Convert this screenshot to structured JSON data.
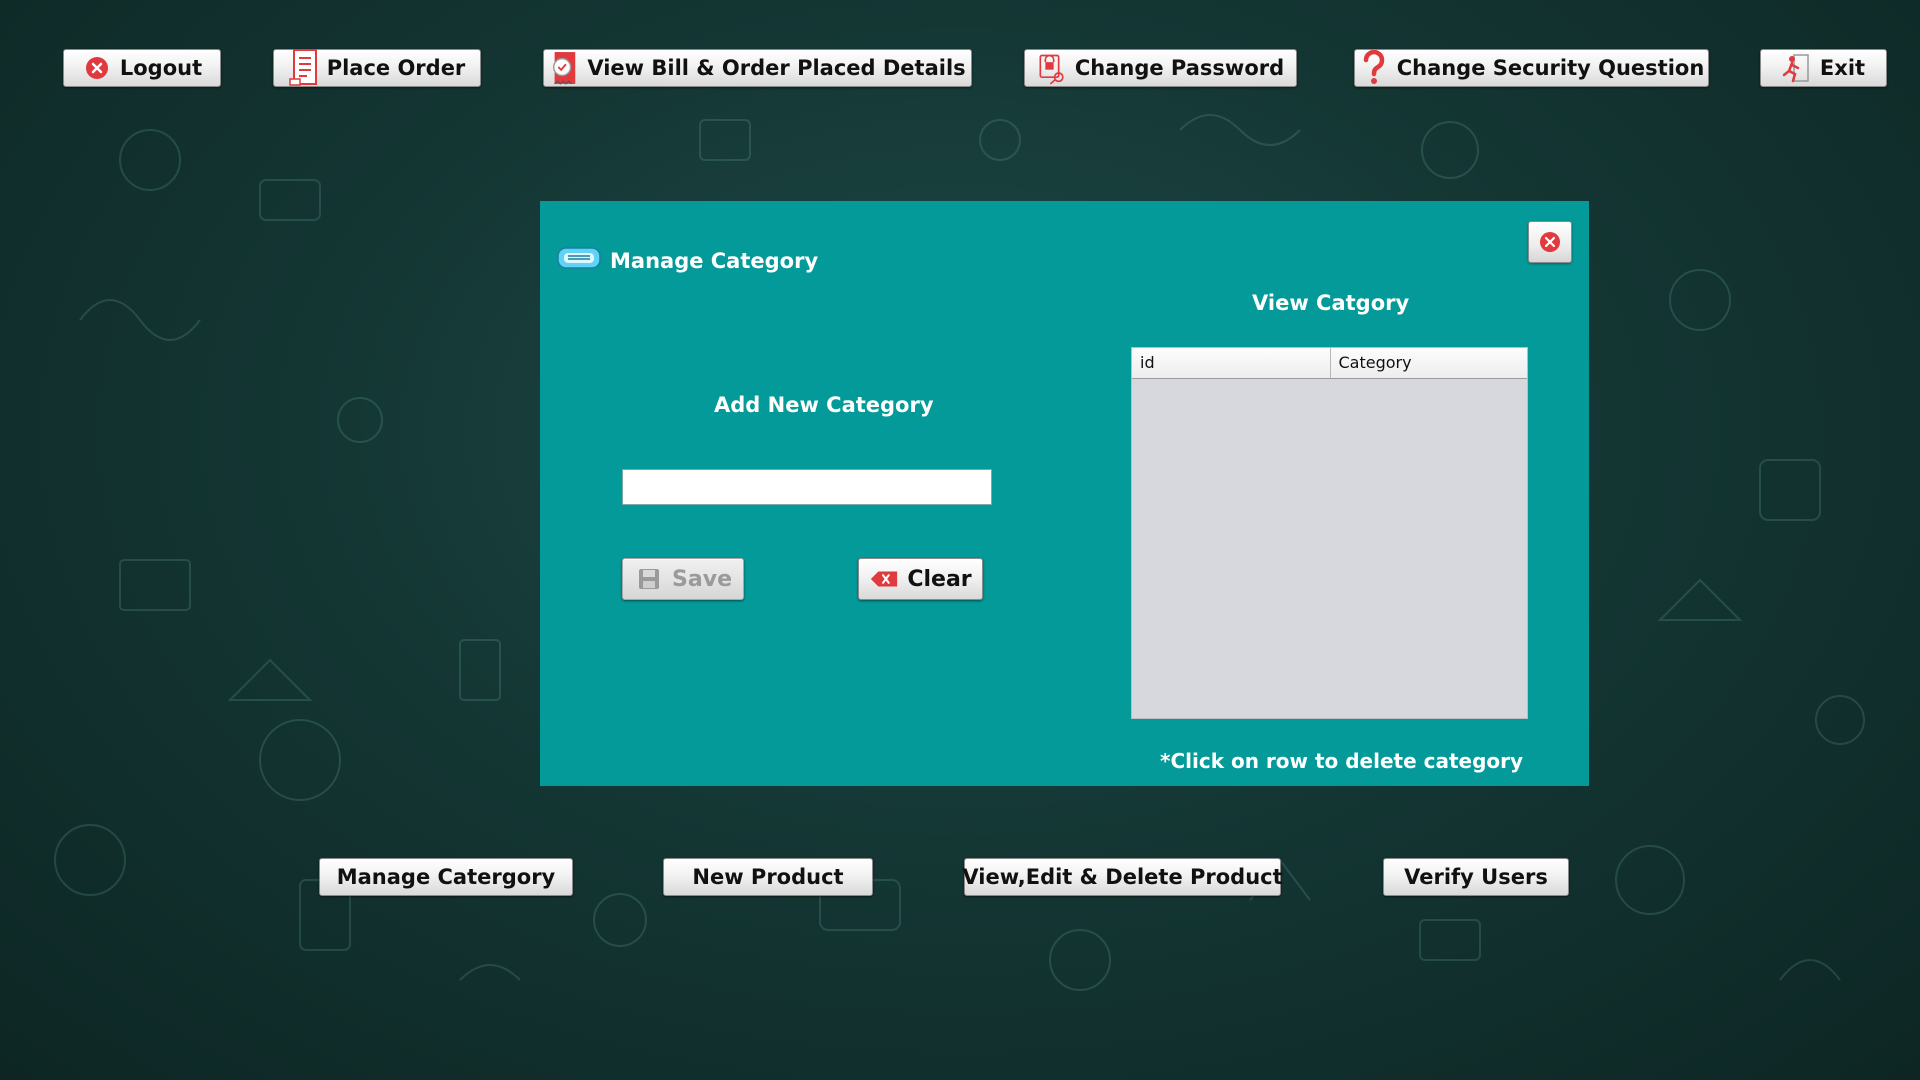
{
  "toolbar": {
    "logout": "Logout",
    "place_order": "Place Order",
    "view_bill": "View Bill & Order Placed Details",
    "change_password": "Change Password",
    "change_security": "Change Security Question",
    "exit": "Exit"
  },
  "dialog": {
    "title": "Manage Category",
    "add_heading": "Add New Category",
    "category_input_value": "",
    "save_label": "Save",
    "clear_label": "Clear",
    "view_heading": "View Catgory",
    "table": {
      "columns": [
        "id",
        "Category"
      ],
      "rows": []
    },
    "hint": "*Click on row to delete category"
  },
  "bottom_nav": {
    "manage_category": "Manage Catergory",
    "new_product": "New Product",
    "view_edit_delete": "View,Edit & Delete Product",
    "verify_users": "Verify Users"
  },
  "colors": {
    "dialog_bg": "#049a99",
    "page_bg": "#143734",
    "danger": "#e0393e"
  },
  "icons": {
    "logout": "close-circle-icon",
    "place_order": "receipt-icon",
    "view_bill": "bill-icon",
    "change_password": "lock-key-icon",
    "change_security": "question-mark-icon",
    "exit": "running-exit-icon",
    "dialog": "category-card-icon",
    "save": "floppy-disk-icon",
    "clear": "eraser-icon"
  }
}
